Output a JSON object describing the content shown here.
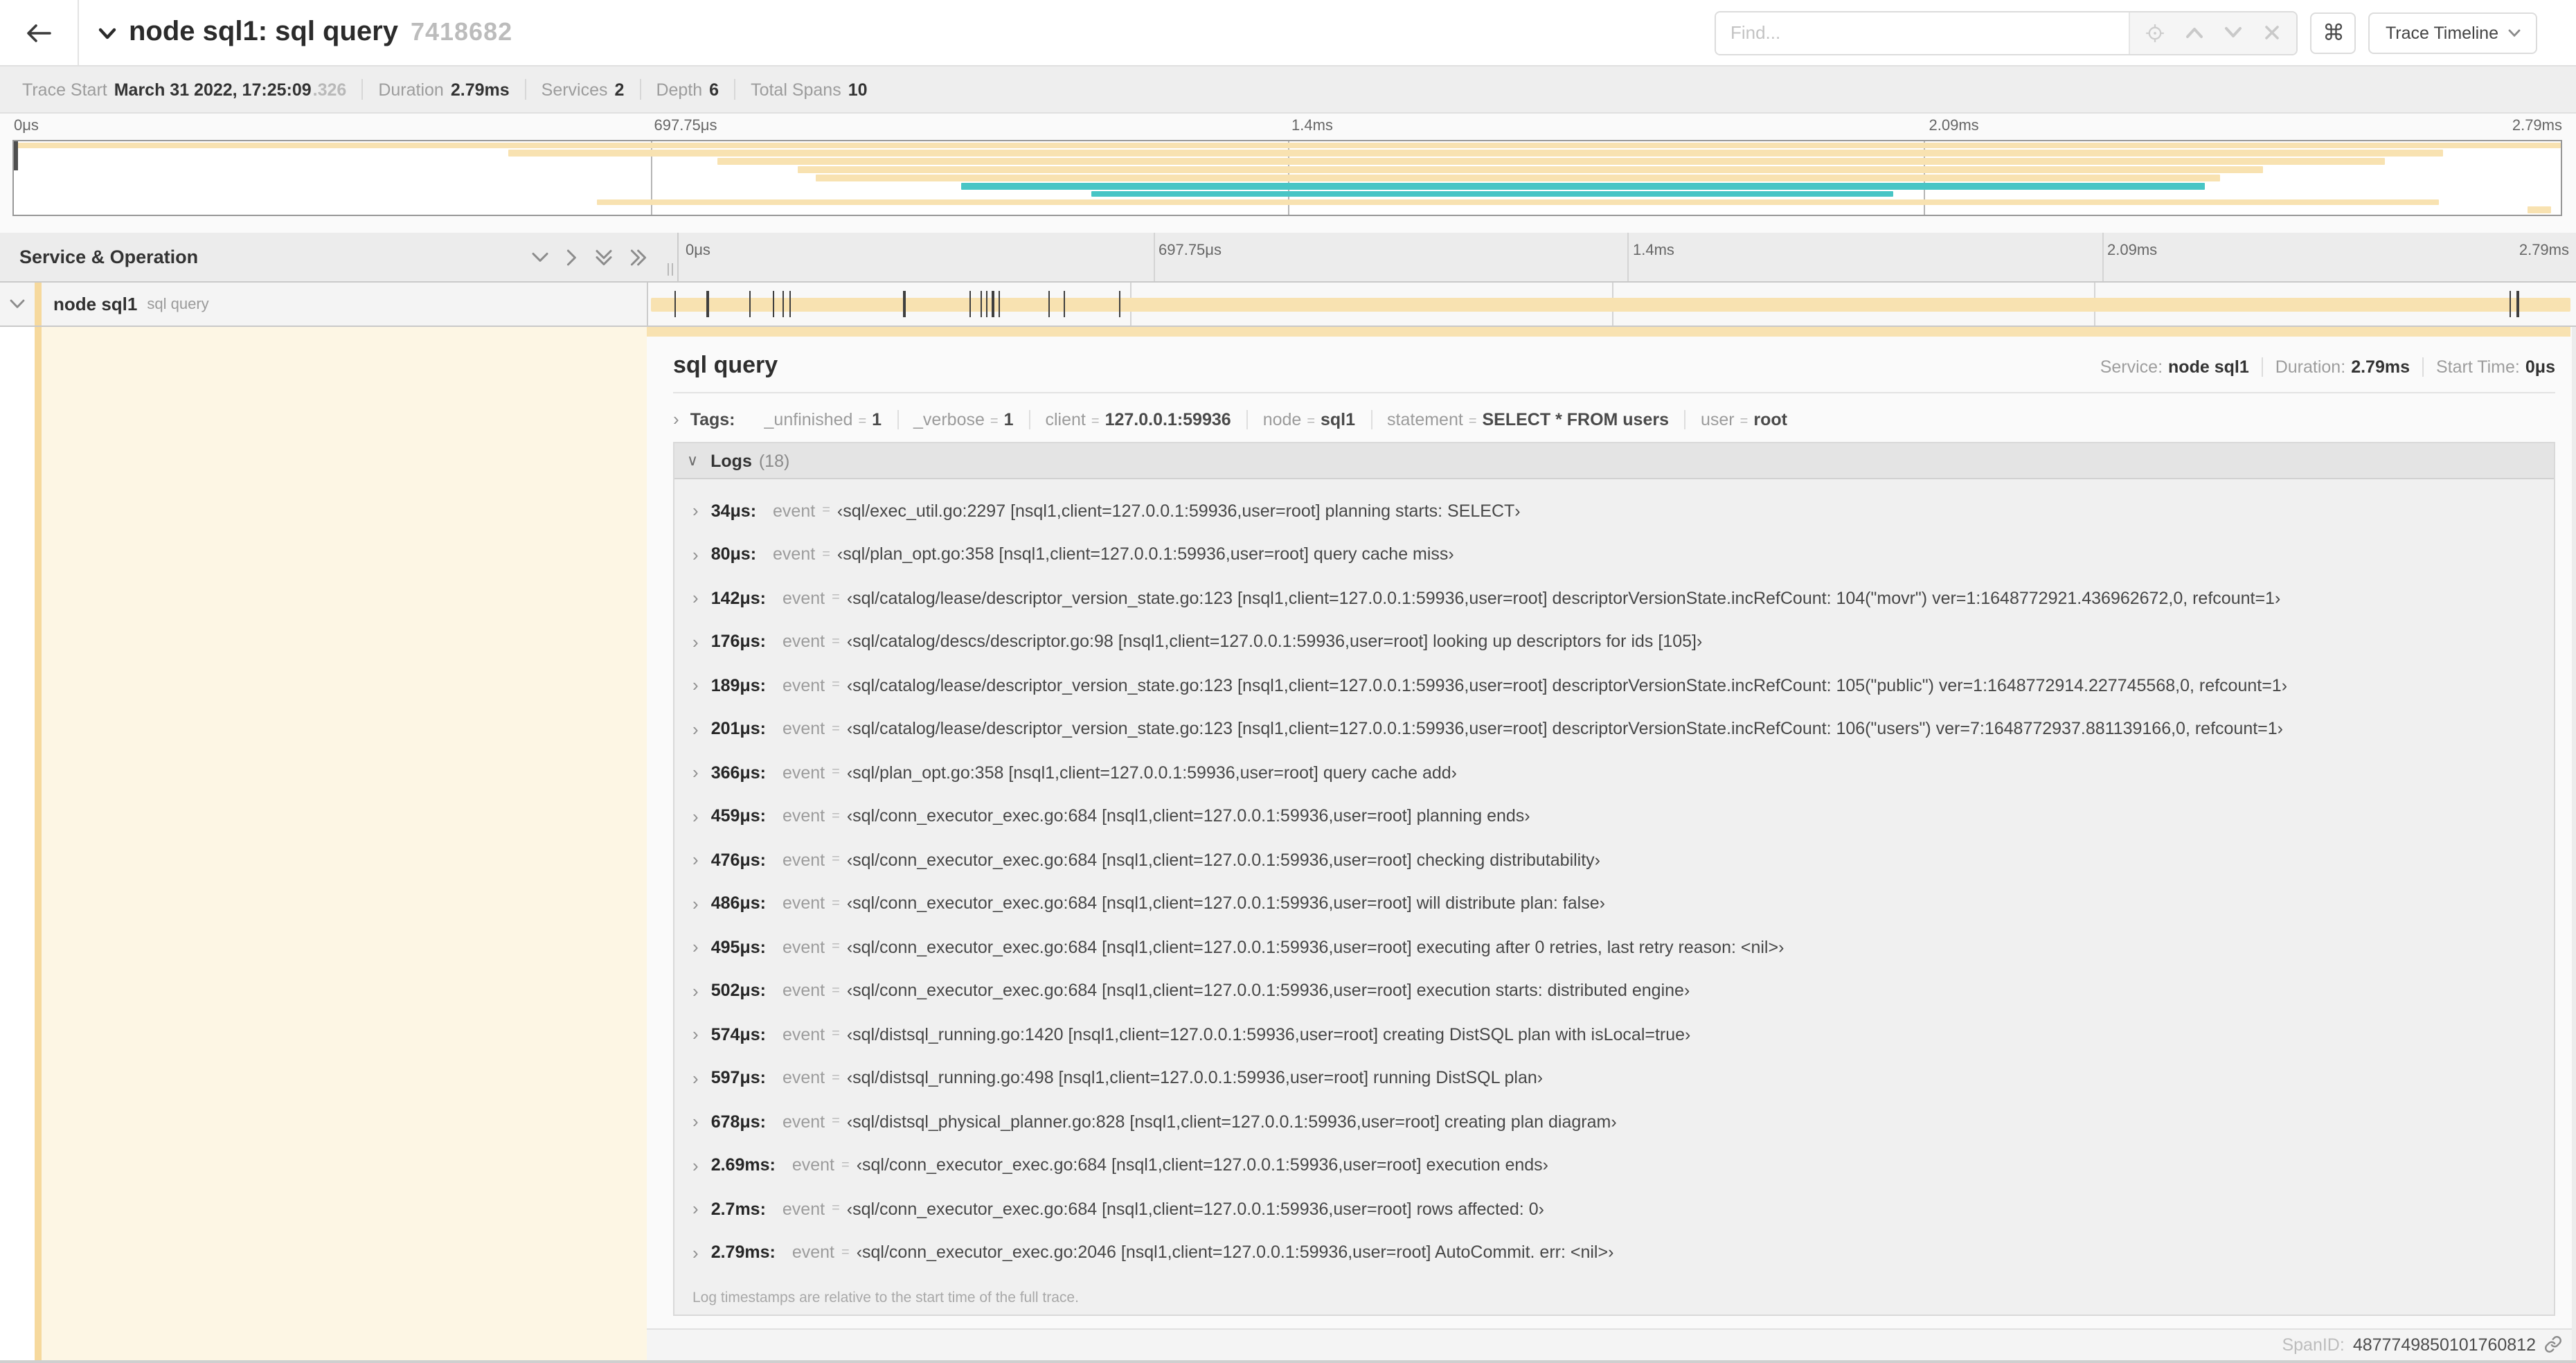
{
  "colors": {
    "span": "#f8e2b1",
    "span_stripe": "#f6d99d",
    "teal": "#48c5c5",
    "detail_tint": "#fdf6e4"
  },
  "header": {
    "title": "node sql1: sql query",
    "trace_id": "7418682",
    "find_placeholder": "Find...",
    "shortcut_key": "⌘",
    "view_select_label": "Trace Timeline"
  },
  "summary": {
    "trace_start_label": "Trace Start",
    "trace_start_value": "March 31 2022, 17:25:09",
    "trace_start_suffix": ".326",
    "duration_label": "Duration",
    "duration_value": "2.79ms",
    "services_label": "Services",
    "services_value": "2",
    "depth_label": "Depth",
    "depth_value": "6",
    "total_spans_label": "Total Spans",
    "total_spans_value": "10"
  },
  "minimap": {
    "ticks": [
      "0μs",
      "697.75μs",
      "1.4ms",
      "2.09ms",
      "2.79ms"
    ],
    "spans": [
      {
        "start_pct": 0,
        "end_pct": 100,
        "color": "span"
      },
      {
        "start_pct": 19.4,
        "end_pct": 95.4,
        "color": "span"
      },
      {
        "start_pct": 27.6,
        "end_pct": 93.1,
        "color": "span"
      },
      {
        "start_pct": 30.8,
        "end_pct": 88.3,
        "color": "span"
      },
      {
        "start_pct": 31.5,
        "end_pct": 86.6,
        "color": "span"
      },
      {
        "start_pct": 37.2,
        "end_pct": 86.0,
        "color": "teal"
      },
      {
        "start_pct": 42.3,
        "end_pct": 73.8,
        "color": "teal"
      },
      {
        "start_pct": 22.9,
        "end_pct": 95.2,
        "color": "span"
      },
      {
        "start_pct": 98.7,
        "end_pct": 99.6,
        "color": "span"
      }
    ]
  },
  "timeline": {
    "left_header": "Service & Operation",
    "ticks": [
      "0μs",
      "697.75μs",
      "1.4ms",
      "2.09ms",
      "2.79ms"
    ],
    "row": {
      "service": "node sql1",
      "operation": "sql query",
      "log_marker_positions_pct": [
        1.2,
        2.9,
        5.1,
        6.3,
        6.8,
        7.2,
        13.1,
        16.5,
        17.1,
        17.4,
        17.7,
        18.0,
        20.6,
        21.4,
        24.3,
        96.4,
        96.8
      ]
    }
  },
  "detail": {
    "title": "sql query",
    "service_label": "Service:",
    "service_value": "node sql1",
    "duration_label": "Duration:",
    "duration_value": "2.79ms",
    "start_label": "Start Time:",
    "start_value": "0μs",
    "tags_label": "Tags:",
    "tags": [
      {
        "key": "_unfinished",
        "value": "1"
      },
      {
        "key": "_verbose",
        "value": "1"
      },
      {
        "key": "client",
        "value": "127.0.0.1:59936"
      },
      {
        "key": "node",
        "value": "sql1"
      },
      {
        "key": "statement",
        "value": "SELECT * FROM users"
      },
      {
        "key": "user",
        "value": "root"
      }
    ],
    "logs_label": "Logs",
    "logs_count": "(18)",
    "logs": [
      {
        "time": "34μs:",
        "key": "event",
        "value": "‹sql/exec_util.go:2297 [nsql1,client=127.0.0.1:59936,user=root] planning starts: SELECT›"
      },
      {
        "time": "80μs:",
        "key": "event",
        "value": "‹sql/plan_opt.go:358 [nsql1,client=127.0.0.1:59936,user=root] query cache miss›"
      },
      {
        "time": "142μs:",
        "key": "event",
        "value": "‹sql/catalog/lease/descriptor_version_state.go:123 [nsql1,client=127.0.0.1:59936,user=root] descriptorVersionState.incRefCount: 104(\"movr\") ver=1:1648772921.436962672,0, refcount=1›"
      },
      {
        "time": "176μs:",
        "key": "event",
        "value": "‹sql/catalog/descs/descriptor.go:98 [nsql1,client=127.0.0.1:59936,user=root] looking up descriptors for ids [105]›"
      },
      {
        "time": "189μs:",
        "key": "event",
        "value": "‹sql/catalog/lease/descriptor_version_state.go:123 [nsql1,client=127.0.0.1:59936,user=root] descriptorVersionState.incRefCount: 105(\"public\") ver=1:1648772914.227745568,0, refcount=1›"
      },
      {
        "time": "201μs:",
        "key": "event",
        "value": "‹sql/catalog/lease/descriptor_version_state.go:123 [nsql1,client=127.0.0.1:59936,user=root] descriptorVersionState.incRefCount: 106(\"users\") ver=7:1648772937.881139166,0, refcount=1›"
      },
      {
        "time": "366μs:",
        "key": "event",
        "value": "‹sql/plan_opt.go:358 [nsql1,client=127.0.0.1:59936,user=root] query cache add›"
      },
      {
        "time": "459μs:",
        "key": "event",
        "value": "‹sql/conn_executor_exec.go:684 [nsql1,client=127.0.0.1:59936,user=root] planning ends›"
      },
      {
        "time": "476μs:",
        "key": "event",
        "value": "‹sql/conn_executor_exec.go:684 [nsql1,client=127.0.0.1:59936,user=root] checking distributability›"
      },
      {
        "time": "486μs:",
        "key": "event",
        "value": "‹sql/conn_executor_exec.go:684 [nsql1,client=127.0.0.1:59936,user=root] will distribute plan: false›"
      },
      {
        "time": "495μs:",
        "key": "event",
        "value": "‹sql/conn_executor_exec.go:684 [nsql1,client=127.0.0.1:59936,user=root] executing after 0 retries, last retry reason: <nil>›"
      },
      {
        "time": "502μs:",
        "key": "event",
        "value": "‹sql/conn_executor_exec.go:684 [nsql1,client=127.0.0.1:59936,user=root] execution starts: distributed engine›"
      },
      {
        "time": "574μs:",
        "key": "event",
        "value": "‹sql/distsql_running.go:1420 [nsql1,client=127.0.0.1:59936,user=root] creating DistSQL plan with isLocal=true›"
      },
      {
        "time": "597μs:",
        "key": "event",
        "value": "‹sql/distsql_running.go:498 [nsql1,client=127.0.0.1:59936,user=root] running DistSQL plan›"
      },
      {
        "time": "678μs:",
        "key": "event",
        "value": "‹sql/distsql_physical_planner.go:828 [nsql1,client=127.0.0.1:59936,user=root] creating plan diagram›"
      },
      {
        "time": "2.69ms:",
        "key": "event",
        "value": "‹sql/conn_executor_exec.go:684 [nsql1,client=127.0.0.1:59936,user=root] execution ends›"
      },
      {
        "time": "2.7ms:",
        "key": "event",
        "value": "‹sql/conn_executor_exec.go:684 [nsql1,client=127.0.0.1:59936,user=root] rows affected: 0›"
      },
      {
        "time": "2.79ms:",
        "key": "event",
        "value": "‹sql/conn_executor_exec.go:2046 [nsql1,client=127.0.0.1:59936,user=root] AutoCommit. err: <nil>›"
      }
    ],
    "footer_note": "Log timestamps are relative to the start time of the full trace.",
    "span_id_label": "SpanID:",
    "span_id_value": "4877749850101760812"
  }
}
